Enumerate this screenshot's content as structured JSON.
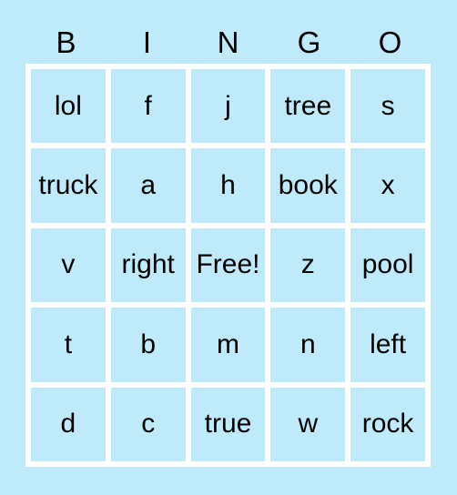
{
  "card": {
    "title": "BINGO",
    "background_color": "#bfeaf9",
    "cell_color": "#bfeaf9",
    "gridline_color": "#ffffff",
    "text_color": "#000000",
    "headers": [
      "B",
      "I",
      "N",
      "G",
      "O"
    ],
    "rows": [
      [
        "lol",
        "f",
        "j",
        "tree",
        "s"
      ],
      [
        "truck",
        "a",
        "h",
        "book",
        "x"
      ],
      [
        "v",
        "right",
        "Free!",
        "z",
        "pool"
      ],
      [
        "t",
        "b",
        "m",
        "n",
        "left"
      ],
      [
        "d",
        "c",
        "true",
        "w",
        "rock"
      ]
    ]
  }
}
